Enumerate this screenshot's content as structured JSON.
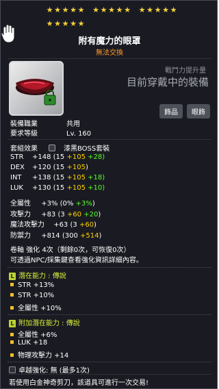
{
  "stars": {
    "row1_groups": [
      5,
      5,
      5
    ],
    "row2_groups": [
      5
    ]
  },
  "item": {
    "name": "附有魔力的眼罩",
    "trade_status": "無法交換",
    "combat_power_label": "戰鬥力提升量",
    "combat_power_value": "目前穿戴中的裝備",
    "tags": [
      "飾品",
      "眼飾"
    ],
    "job_label": "裝備職業",
    "job_value": "共用",
    "level_label": "要求等級",
    "level_value": "Lv. 160",
    "set_label": "套組效果",
    "set_value": "漆黑BOSS套裝"
  },
  "stats": [
    {
      "name": "STR",
      "total": "+148",
      "base": "(15 ",
      "y": "+105",
      "g": " +28)"
    },
    {
      "name": "DEX",
      "total": "+120",
      "base": "(15 ",
      "y": "+105",
      "g": ")"
    },
    {
      "name": "INT",
      "total": "+138",
      "base": "(15 ",
      "y": "+105",
      "g": " +18)"
    },
    {
      "name": "LUK",
      "total": "+130",
      "base": "(15 ",
      "y": "+105",
      "g": " +10)"
    }
  ],
  "stats2": [
    {
      "name": "全屬性",
      "total": "+3%",
      "base": "(0% ",
      "y": "",
      "g": "+3%",
      "tail": ")"
    },
    {
      "name": "攻擊力",
      "total": "+83",
      "base": "(3 ",
      "y": "+60",
      "g": " +20",
      "tail": ")"
    },
    {
      "name": "魔法攻擊力",
      "total": "+63",
      "base": "(3 ",
      "y": "+60",
      "g": "",
      "tail": ")"
    },
    {
      "name": "防禦力",
      "total": "+814",
      "base": "(300 ",
      "y": "+514",
      "g": "",
      "tail": ")"
    }
  ],
  "upgrade": {
    "line": "卷軸 強化 4次（剩餘0次，可恢復0次）",
    "hint": "可透過NPC/採集鍵查看強化資訊詳細內容。"
  },
  "potential": {
    "title": "潛在能力 : 傳說",
    "lines": [
      "STR +13%",
      "STR +10%",
      "全屬性 +10%"
    ]
  },
  "additional": {
    "title": "附加潛在能力 : 傳說",
    "lines": [
      "全屬性 +6%",
      "LUK +18",
      "物理攻擊力 +14"
    ]
  },
  "transcend": {
    "label": "卓越強化:",
    "value": "無 (最多1次)"
  },
  "footer": "若使用白金神奇剪刀，該道具可進行一次交易!",
  "colors": {
    "background": "#1a1b22",
    "star": "#f6d23d",
    "trade": "#ff9a2c",
    "yellow": "#ffd200",
    "green": "#55ff2a",
    "legend": "#d8ee3a"
  }
}
